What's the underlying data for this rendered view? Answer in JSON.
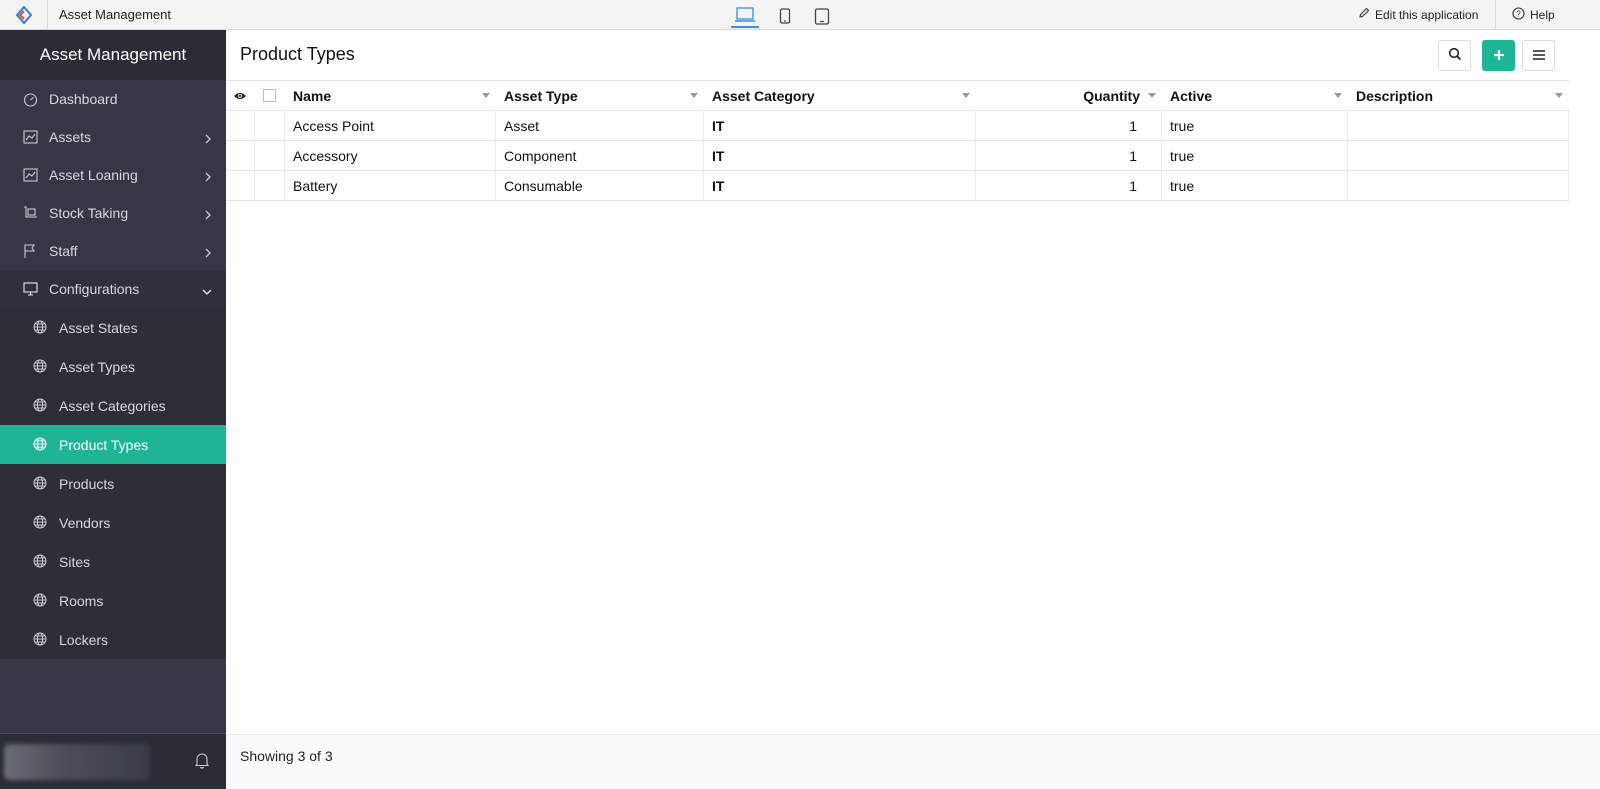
{
  "topbar": {
    "app_title": "Asset Management",
    "edit_label": "Edit this application",
    "help_label": "Help"
  },
  "sidebar": {
    "title": "Asset Management",
    "items": [
      {
        "label": "Dashboard",
        "icon": "dashboard-icon"
      },
      {
        "label": "Assets",
        "icon": "chart-icon"
      },
      {
        "label": "Asset Loaning",
        "icon": "chart-icon"
      },
      {
        "label": "Stock Taking",
        "icon": "cart-icon"
      },
      {
        "label": "Staff",
        "icon": "flag-icon"
      },
      {
        "label": "Configurations",
        "icon": "monitor-icon"
      }
    ],
    "sub_items": [
      {
        "label": "Asset States"
      },
      {
        "label": "Asset Types"
      },
      {
        "label": "Asset Categories"
      },
      {
        "label": "Product Types"
      },
      {
        "label": "Products"
      },
      {
        "label": "Vendors"
      },
      {
        "label": "Sites"
      },
      {
        "label": "Rooms"
      },
      {
        "label": "Lockers"
      }
    ],
    "active_item": "Product Types"
  },
  "main": {
    "title": "Product Types",
    "columns": [
      "Name",
      "Asset Type",
      "Asset Category",
      "Quantity",
      "Active",
      "Description"
    ],
    "rows": [
      {
        "name": "Access Point",
        "asset_type": "Asset",
        "asset_category": "IT",
        "quantity": "1",
        "active": "true",
        "description": ""
      },
      {
        "name": "Accessory",
        "asset_type": "Component",
        "asset_category": "IT",
        "quantity": "1",
        "active": "true",
        "description": ""
      },
      {
        "name": "Battery",
        "asset_type": "Consumable",
        "asset_category": "IT",
        "quantity": "1",
        "active": "true",
        "description": ""
      }
    ],
    "footer": "Showing 3 of 3"
  },
  "colors": {
    "accent": "#1fb496",
    "sidebar_bg": "#353844",
    "sidebar_header_bg": "#2a2d36"
  }
}
